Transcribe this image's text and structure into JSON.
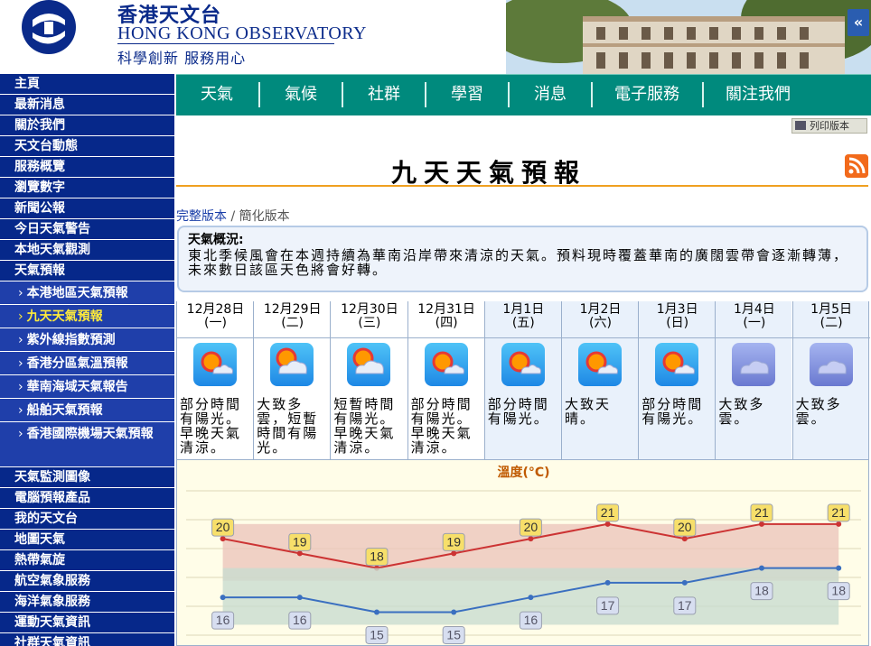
{
  "header": {
    "brand_zh": "香港天文台",
    "brand_en": "HONG KONG OBSERVATORY",
    "slogan": "科學創新 服務用心",
    "collapse": "«"
  },
  "sidebar": {
    "items": [
      {
        "label": "主頁"
      },
      {
        "label": "最新消息"
      },
      {
        "label": "關於我們"
      },
      {
        "label": "天文台動態"
      },
      {
        "label": "服務概覽"
      },
      {
        "label": "瀏覽數字"
      },
      {
        "label": "新聞公報"
      },
      {
        "label": "今日天氣警告"
      },
      {
        "label": "本地天氣觀測"
      },
      {
        "label": "天氣預報"
      }
    ],
    "subitems": [
      {
        "label": "本港地區天氣預報"
      },
      {
        "label": "九天天氣預報"
      },
      {
        "label": "紫外線指數預測"
      },
      {
        "label": "香港分區氣溫預報"
      },
      {
        "label": "華南海域天氣報告"
      },
      {
        "label": "船舶天氣預報"
      },
      {
        "label": "香港國際機場天氣預報"
      }
    ],
    "items2": [
      {
        "label": "天氣監測圖像"
      },
      {
        "label": "電腦預報產品"
      },
      {
        "label": "我的天文台"
      },
      {
        "label": "地圖天氣"
      },
      {
        "label": "熱帶氣旋"
      },
      {
        "label": "航空氣象服務"
      },
      {
        "label": "海洋氣象服務"
      },
      {
        "label": "運動天氣資訊"
      },
      {
        "label": "社群天氣資訊"
      }
    ]
  },
  "topnav": {
    "items": [
      "天氣",
      "氣候",
      "社群",
      "學習",
      "消息",
      "電子服務",
      "關注我們"
    ]
  },
  "print_label": "列印版本",
  "page_title": "九天天氣預報",
  "version": {
    "full": "完整版本",
    "sep": " / ",
    "simple": "簡化版本"
  },
  "overview": {
    "heading": "天氣概況:",
    "text": "東北季候風會在本週持續為華南沿岸帶來清涼的天氣。預料現時覆蓋華南的廣闊雲帶會逐漸轉薄，未來數日該區天色將會好轉。"
  },
  "days": [
    {
      "date": "12月28日",
      "weekday": "(一)",
      "icon": "sun-cloud-icon",
      "desc": "部分時間有陽光。早晚天氣清涼。"
    },
    {
      "date": "12月29日",
      "weekday": "(二)",
      "icon": "sun-behind-cloud-icon",
      "desc": "大致多雲，短暫時間有陽光。"
    },
    {
      "date": "12月30日",
      "weekday": "(三)",
      "icon": "sun-behind-cloud-icon",
      "desc": "短暫時間有陽光。早晚天氣清涼。"
    },
    {
      "date": "12月31日",
      "weekday": "(四)",
      "icon": "sun-cloud-icon",
      "desc": "部分時間有陽光。早晚天氣清涼。"
    },
    {
      "date": "1月1日",
      "weekday": "(五)",
      "icon": "sun-cloud-icon",
      "desc": "部分時間有陽光。"
    },
    {
      "date": "1月2日",
      "weekday": "(六)",
      "icon": "sun-cloud-icon",
      "desc": "大致天晴。"
    },
    {
      "date": "1月3日",
      "weekday": "(日)",
      "icon": "sun-cloud-icon",
      "desc": "部分時間有陽光。"
    },
    {
      "date": "1月4日",
      "weekday": "(一)",
      "icon": "cloud-icon",
      "desc": "大致多雲。"
    },
    {
      "date": "1月5日",
      "weekday": "(二)",
      "icon": "cloud-icon",
      "desc": "大致多雲。"
    }
  ],
  "chart_title": "溫度(°C)",
  "colors": {
    "max_line": "#cc3333",
    "min_line": "#3a6fc0",
    "max_band": "#ecc6bc",
    "min_band": "#c9dcd0",
    "max_label_bg": "#f7df6a",
    "min_label_bg": "#d7def0"
  },
  "chart_data": {
    "type": "line",
    "series": [
      {
        "name": "max",
        "values": [
          20,
          19,
          18,
          19,
          20,
          21,
          20,
          21,
          21
        ]
      },
      {
        "name": "min",
        "values": [
          16,
          16,
          15,
          15,
          16,
          17,
          17,
          18,
          18
        ]
      }
    ],
    "ylim": [
      13,
      24
    ]
  }
}
